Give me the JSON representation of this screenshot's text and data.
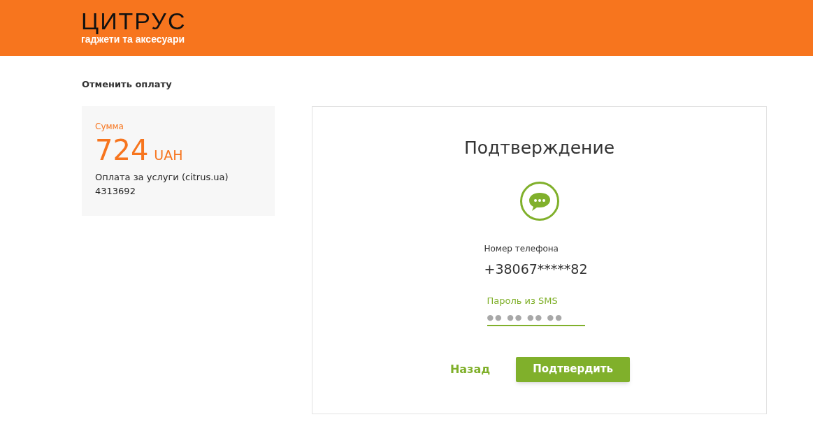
{
  "header": {
    "logo_title": "ЦИТРУС",
    "logo_subtitle": "гаджети та аксесуари"
  },
  "cancel_link": "Отменить оплату",
  "summary": {
    "label": "Сумма",
    "amount": "724",
    "currency": "UAH",
    "description": "Оплата за услуги (citrus.ua)",
    "order": "4313692"
  },
  "confirmation": {
    "title": "Подтверждение",
    "phone_label": "Номер телефона",
    "phone": "+38067*****82",
    "sms_field": {
      "label": "Пароль из SMS",
      "placeholder": "●● ●● ●● ●●"
    },
    "buttons": [
      {
        "kind": "link",
        "label": "Назад"
      },
      {
        "kind": "primary",
        "label": "Подтвердить"
      }
    ]
  }
}
